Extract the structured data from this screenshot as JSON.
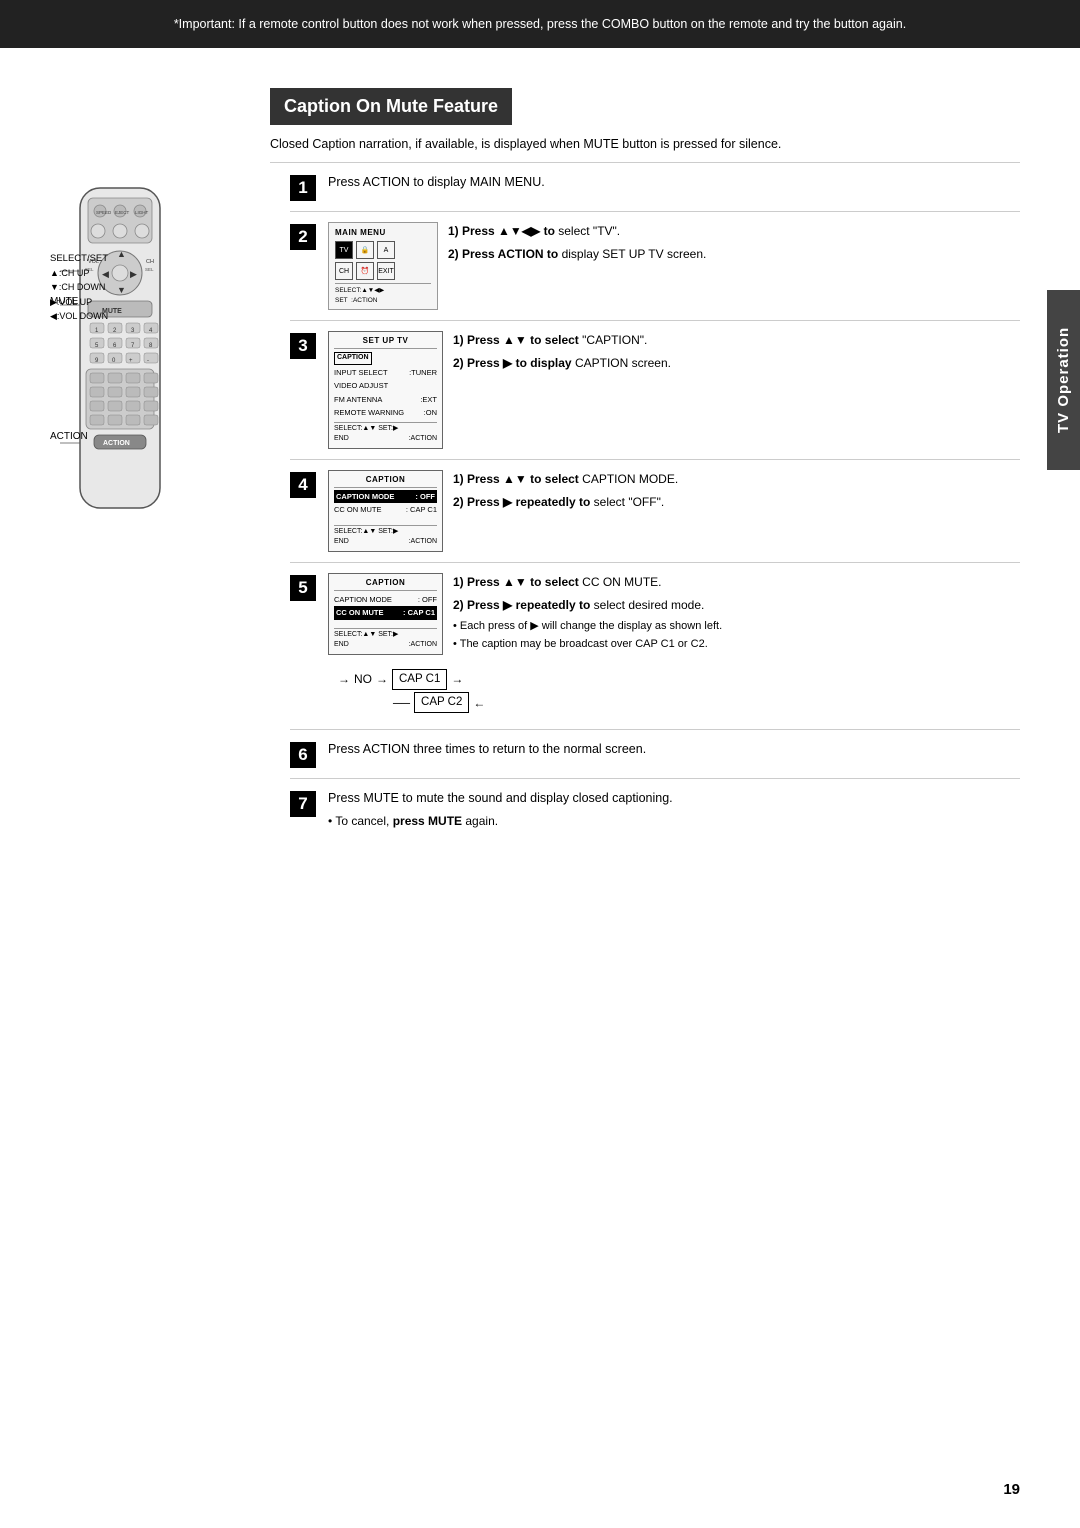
{
  "notice": {
    "text": "*Important: If a remote control button does not work when pressed, press the COMBO button on the remote and try the button again."
  },
  "section": {
    "title": "Caption On Mute Feature",
    "subtitle": "Closed Caption narration, if available, is displayed when MUTE button is pressed for silence."
  },
  "tv_operation_label": "TV Operation",
  "remote_labels": {
    "mute": "MUTE",
    "select_set": "SELECT/SET",
    "ch_up": "▲:CH UP",
    "ch_down": "▼:CH DOWN",
    "vol_up": "▶:VOL UP",
    "vol_down": "◀:VOL DOWN",
    "action": "ACTION"
  },
  "steps": [
    {
      "number": "1",
      "text": "Press ACTION to display MAIN MENU."
    },
    {
      "number": "2",
      "sub1_label": "1) Press ▲▼◀▶ to",
      "sub1_text": "select \"TV\".",
      "sub2_label": "2) Press ACTION to",
      "sub2_text": "display SET UP TV screen.",
      "screen_title": "MAIN MENU",
      "screen_items": [
        "TV",
        "LOCK",
        "LANGUAGE",
        "CH",
        "CLOCK",
        "EXIT"
      ]
    },
    {
      "number": "3",
      "sub1_label": "1) Press ▲▼ to select",
      "sub1_text": "\"CAPTION\".",
      "sub2_label": "2) Press ▶ to display",
      "sub2_text": "CAPTION screen.",
      "screen_title": "SET UP TV",
      "screen_rows": [
        [
          "INPUT SELECT",
          ":TUNER"
        ],
        [
          "VIDEO ADJUST",
          ""
        ],
        [
          "FM ANTENNA",
          ":EXT"
        ],
        [
          "REMOTE WARNING",
          ":ON"
        ]
      ],
      "screen_footer": "SELECT:▲▼  SET:▶\nEND  :ACTION"
    },
    {
      "number": "4",
      "sub1_label": "1) Press ▲▼ to select",
      "sub1_text": "CAPTION MODE.",
      "sub2_label": "2) Press ▶ repeatedly to",
      "sub2_text": "select \"OFF\".",
      "screen_title": "CAPTION",
      "screen_rows": [
        [
          "CAPTION MODE",
          ": OFF",
          true
        ],
        [
          "CC ON MUTE",
          ": CAP C1",
          false
        ]
      ],
      "screen_footer": "SELECT:▲▼  SET:▶\nEND  :ACTION"
    },
    {
      "number": "5",
      "sub1_label": "1) Press ▲▼ to select",
      "sub1_text": "CC ON MUTE.",
      "sub2_label": "2) Press ▶ repeatedly to",
      "sub2_text": "select desired mode.",
      "bullets": [
        "Each press of ▶ will change the display as shown left.",
        "The caption may be broadcast over CAP C1 or C2."
      ],
      "screen_title": "CAPTION",
      "screen_rows": [
        [
          "CAPTION MODE",
          ": OFF",
          false
        ],
        [
          "CC ON MUTE",
          ": CAP C1",
          true
        ]
      ],
      "screen_footer": "SELECT:▲▼  SET:▶\nEND  :ACTION",
      "diagram_line1": "NO → CAP C1",
      "diagram_line2": "CAP C2"
    },
    {
      "number": "6",
      "text": "Press ACTION three times to return to the normal screen."
    },
    {
      "number": "7",
      "text": "Press MUTE to mute the sound and display closed captioning.",
      "bullet": "To cancel, press MUTE again."
    }
  ],
  "page_number": "19"
}
